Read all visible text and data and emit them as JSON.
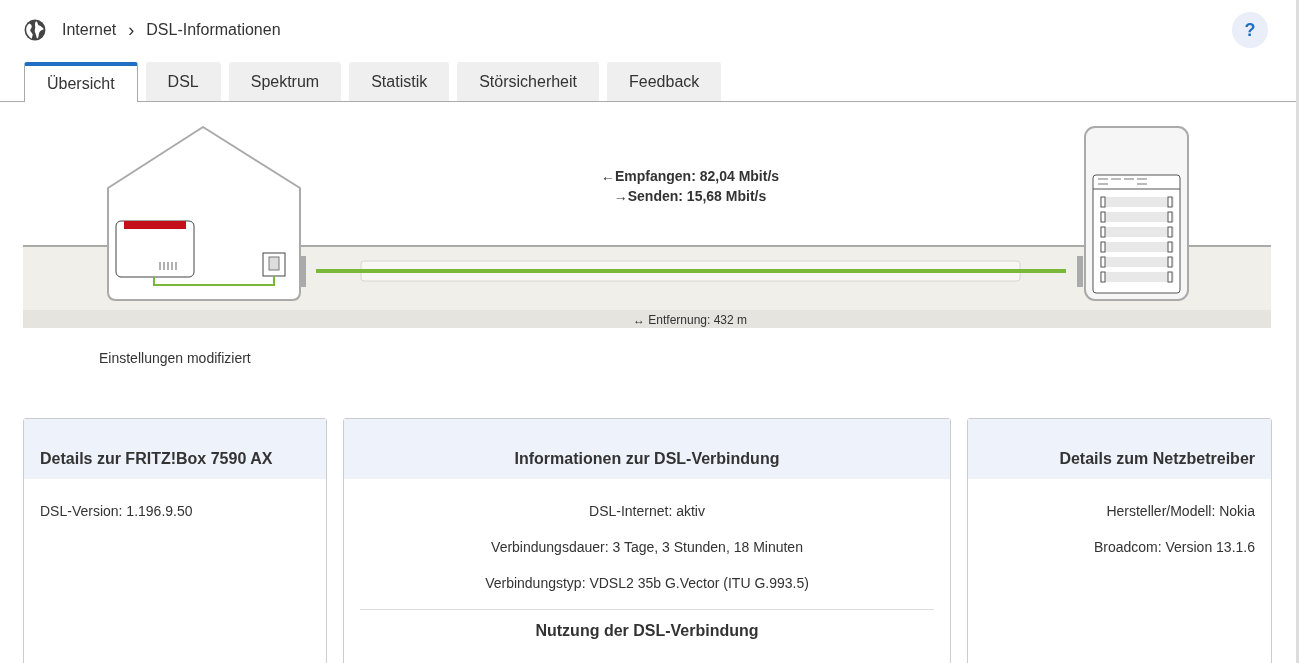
{
  "breadcrumb": {
    "section": "Internet",
    "separator": "›",
    "page": "DSL-Informationen"
  },
  "help": "?",
  "tabs": [
    {
      "label": "Übersicht",
      "selected": true
    },
    {
      "label": "DSL",
      "selected": false
    },
    {
      "label": "Spektrum",
      "selected": false
    },
    {
      "label": "Statistik",
      "selected": false
    },
    {
      "label": "Störsicherheit",
      "selected": false
    },
    {
      "label": "Feedback",
      "selected": false
    }
  ],
  "diagram": {
    "receive": "←Empfangen: 82,04 Mbit/s",
    "send": "→Senden: 15,68 Mbit/s",
    "distance": "↔ Entfernung: 432 m",
    "note": "Einstellungen modifiziert"
  },
  "cards": [
    {
      "kind": "device",
      "title": "Details zur FRITZ!Box 7590 AX",
      "lines": [
        "DSL-Version: 1.196.9.50"
      ]
    },
    {
      "kind": "connection",
      "title": "Informationen zur DSL-Verbindung",
      "lines": [
        "DSL-Internet: aktiv",
        "Verbindungsdauer: 3 Tage, 3 Stunden, 18 Minuten",
        "Verbindungstyp: VDSL2 35b G.Vector (ITU G.993.5)"
      ],
      "subheading": "Nutzung der DSL-Verbindung"
    },
    {
      "kind": "provider",
      "title": "Details zum Netzbetreiber",
      "lines": [
        "Hersteller/Modell: Nokia",
        "Broadcom: Version 13.1.6"
      ]
    }
  ]
}
